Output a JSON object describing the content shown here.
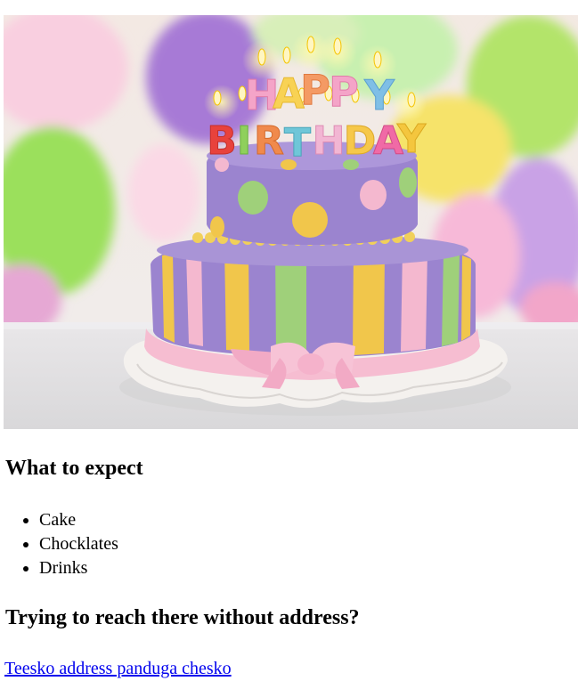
{
  "hero_image": {
    "alt": "Happy Birthday cake",
    "candle_letters_top": [
      "H",
      "A",
      "P",
      "P",
      "Y"
    ],
    "candle_letters_bottom": [
      "B",
      "I",
      "R",
      "T",
      "H",
      "D",
      "A",
      "Y"
    ],
    "colors": {
      "balloon_purple": "#a77ad6",
      "balloon_green": "#9be05c",
      "balloon_yellow": "#f6e36a",
      "balloon_pink": "#f4b0d2",
      "cake_purple": "#9b84cf",
      "cake_yellow": "#f1c64b",
      "cake_green": "#9fd07a",
      "cake_pink": "#f4b8cf",
      "ribbon_pink": "#f6bdd1",
      "board": "#f4f1ee"
    }
  },
  "section1": {
    "heading": "What to expect",
    "items": [
      "Cake",
      "Chocklates",
      "Drinks"
    ]
  },
  "section2": {
    "heading": "Trying to reach there without address?",
    "link_text": "Teesko address panduga chesko"
  }
}
